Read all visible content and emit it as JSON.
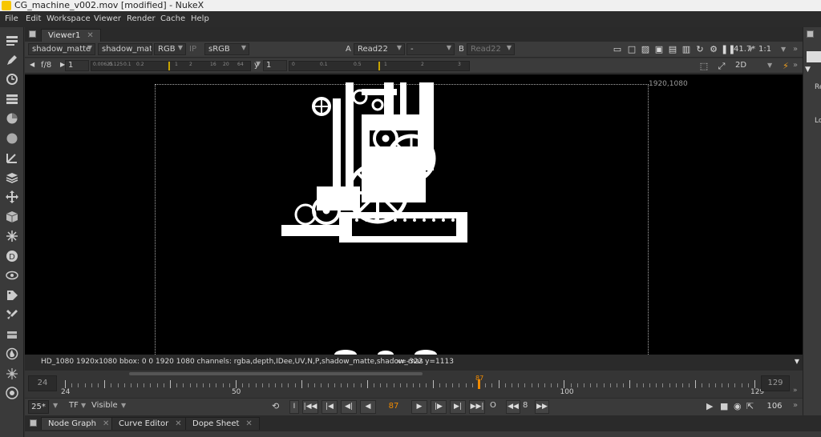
{
  "window": {
    "title": "CG_machine_v002.mov [modified] - NukeX"
  },
  "menu": [
    "File",
    "Edit",
    "Workspace",
    "Viewer",
    "Render",
    "Cache",
    "Help"
  ],
  "viewer_tab": {
    "label": "Viewer1",
    "close": "✕"
  },
  "controls": {
    "channel_set": "shadow_matte",
    "channel": "shadow_matte",
    "display_channels": "RGB",
    "ip_label": "IP",
    "lut": "sRGB",
    "input_a_letter": "A",
    "input_a": "Read22",
    "composite_mode": "-",
    "input_b_letter": "B",
    "input_b": "Read22",
    "zoom": "41.7*",
    "proxy": "1:1",
    "fstop": "f/8",
    "gain": "1",
    "gamma_label": "y",
    "gamma": "1",
    "view_mode": "2D",
    "gain_ticks": [
      "0.00625",
      "0.125",
      "0.1",
      "0.2",
      "1",
      "2",
      "16",
      "20",
      "64"
    ],
    "gamma_ticks": [
      "0",
      "0.1",
      "0.5",
      "1",
      "2",
      "3"
    ]
  },
  "viewer": {
    "resolution_label": "1920,1080"
  },
  "infobar": {
    "info": "HD_1080 1920x1080  bbox: 0 0 1920 1080 channels: rgba,depth,IDee,UV,N,P,shadow_matte,shadow_mas",
    "coords": "x=-322 y=1113"
  },
  "timeline": {
    "in_frame": "24",
    "out_frame": "129",
    "start": 24,
    "end": 129,
    "current": 87,
    "current_label": "87",
    "labels": [
      "24",
      "50",
      "100",
      "129"
    ]
  },
  "transport": {
    "fps": "25*",
    "tf": "TF",
    "visible": "Visible",
    "frame": "87",
    "increment": "8",
    "end_frame": "106"
  },
  "bottom_tabs": [
    {
      "label": "Node Graph",
      "close": "✕"
    },
    {
      "label": "Curve Editor",
      "close": "✕"
    },
    {
      "label": "Dope Sheet",
      "close": "✕"
    }
  ],
  "right_panel": {
    "label1": "Re",
    "label2": "Lo"
  },
  "colors": {
    "accent": "#f08a00",
    "background": "#323232",
    "viewer": "#000000"
  }
}
